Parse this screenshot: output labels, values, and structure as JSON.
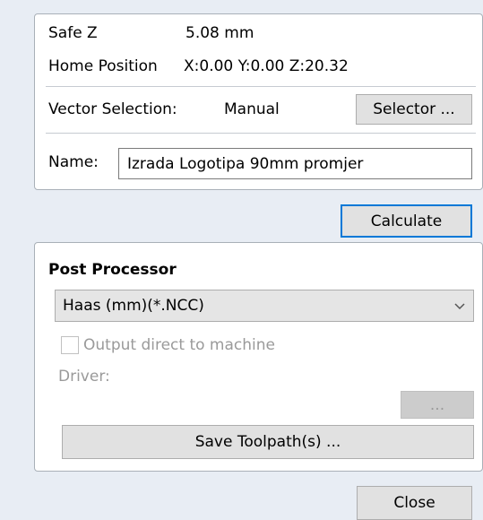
{
  "safe_z": {
    "label": "Safe Z",
    "value": "5.08 mm"
  },
  "home_position": {
    "label": "Home Position",
    "value": "X:0.00 Y:0.00 Z:20.32"
  },
  "vector_selection": {
    "label": "Vector Selection:",
    "value": "Manual",
    "selector_button": "Selector ..."
  },
  "name": {
    "label": "Name:",
    "value": "Izrada Logotipa 90mm promjer"
  },
  "calculate_button": "Calculate",
  "post_processor": {
    "title": "Post Processor",
    "selected": "Haas (mm)(*.NCC)",
    "output_direct_label": "Output direct to machine",
    "output_direct_checked": false,
    "driver_label": "Driver:",
    "driver_browse_button": "...",
    "save_button": "Save Toolpath(s) ..."
  },
  "close_button": "Close",
  "colors": {
    "background": "#e8edf4",
    "default_button_border": "#0078d7",
    "disabled_text": "#9a9a9a"
  },
  "icons": {
    "dropdown": "chevron-down-icon"
  }
}
